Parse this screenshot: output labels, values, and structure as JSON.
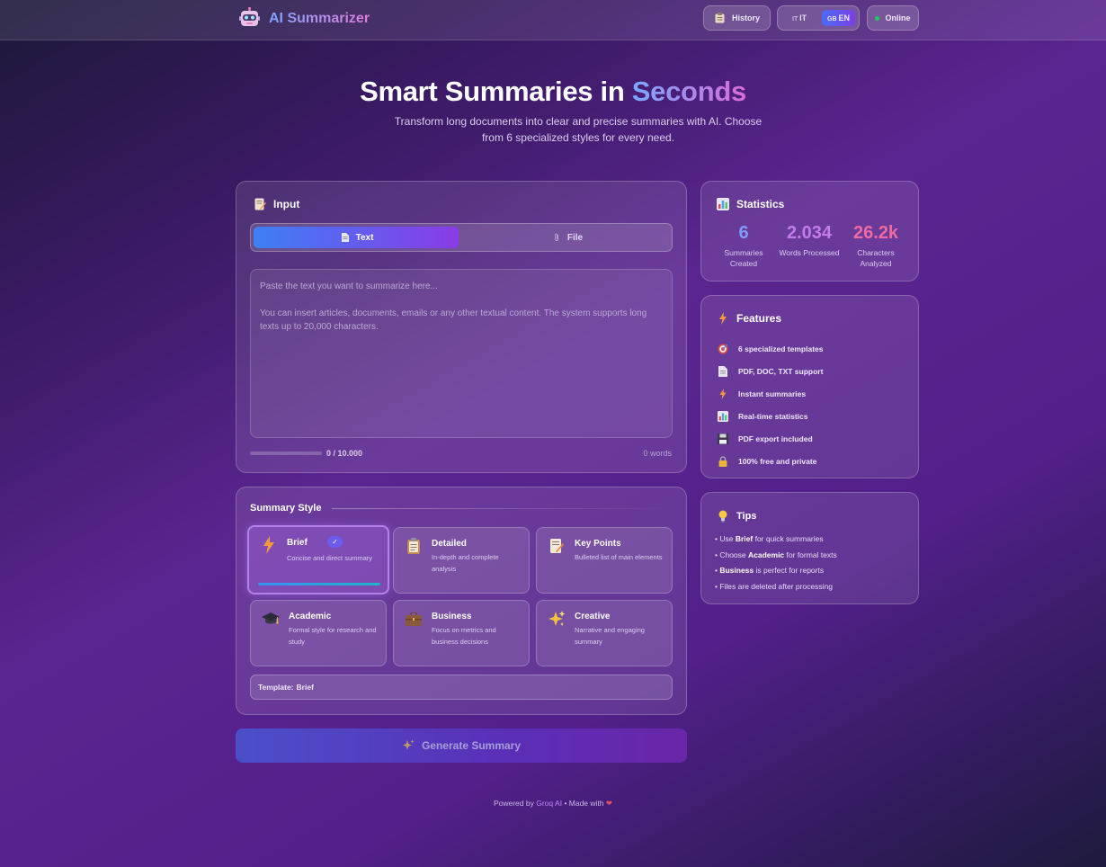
{
  "header": {
    "title": "AI Summarizer",
    "history_label": "History",
    "lang_it": "IT",
    "lang_en": "EN",
    "status": "Online"
  },
  "hero": {
    "title_main": "Smart Summaries in",
    "title_accent": "Seconds",
    "subtitle": "Transform long documents into clear and precise summaries with AI. Choose from 6 specialized styles for every need."
  },
  "input": {
    "title": "Input",
    "tab_text": "Text",
    "tab_file": "File",
    "placeholder_line1": "Paste the text you want to summarize here...",
    "placeholder_line2": "You can insert articles, documents, emails or any other textual content. The system supports long texts up to 20,000 characters.",
    "char_count": "0 / 10.000",
    "word_count": "0 words",
    "progress": 0
  },
  "style": {
    "title": "Summary Style",
    "templates": [
      {
        "name": "Brief",
        "desc": "Concise and direct summary",
        "icon": "lightning-icon",
        "selected": true
      },
      {
        "name": "Detailed",
        "desc": "In-depth and complete analysis",
        "icon": "clipboard-icon",
        "selected": false
      },
      {
        "name": "Key Points",
        "desc": "Bulleted list of main elements",
        "icon": "memo-icon",
        "selected": false
      },
      {
        "name": "Academic",
        "desc": "Formal style for research and study",
        "icon": "graduation-cap-icon",
        "selected": false
      },
      {
        "name": "Business",
        "desc": "Focus on metrics and business decisions",
        "icon": "briefcase-icon",
        "selected": false
      },
      {
        "name": "Creative",
        "desc": "Narrative and engaging summary",
        "icon": "sparkles-icon",
        "selected": false
      }
    ],
    "template_label": "Template:",
    "template_value": "Brief"
  },
  "generate_label": "Generate Summary",
  "statistics": {
    "title": "Statistics",
    "items": [
      {
        "value": "6",
        "label": "Summaries Created",
        "color": "#7f9df7"
      },
      {
        "value": "2.034",
        "label": "Words Processed",
        "color": "#c27be8"
      },
      {
        "value": "26.2k",
        "label": "Characters Analyzed",
        "color": "#ef6aa0"
      }
    ]
  },
  "features": {
    "title": "Features",
    "items": [
      {
        "text": "6 specialized templates",
        "icon": "target-icon"
      },
      {
        "text": "PDF, DOC, TXT support",
        "icon": "document-icon"
      },
      {
        "text": "Instant summaries",
        "icon": "lightning-icon"
      },
      {
        "text": "Real-time statistics",
        "icon": "bar-chart-icon"
      },
      {
        "text": "PDF export included",
        "icon": "floppy-disk-icon"
      },
      {
        "text": "100% free and private",
        "icon": "lock-icon"
      }
    ]
  },
  "tips": {
    "title": "Tips",
    "items": [
      {
        "pre": "• Use ",
        "bold": "Brief",
        "post": " for quick summaries"
      },
      {
        "pre": "• Choose ",
        "bold": "Academic",
        "post": " for formal texts"
      },
      {
        "pre": "• ",
        "bold": "Business",
        "post": " is perfect for reports"
      },
      {
        "pre": "• Files are deleted after processing",
        "bold": "",
        "post": ""
      }
    ]
  },
  "footer": {
    "prefix": "Powered by",
    "groq": "Groq AI",
    "middle": "• Made with"
  },
  "colors": {
    "accent_blue": "#3d7ff5",
    "accent_purple": "#8a3be6",
    "online": "#22c55e"
  }
}
